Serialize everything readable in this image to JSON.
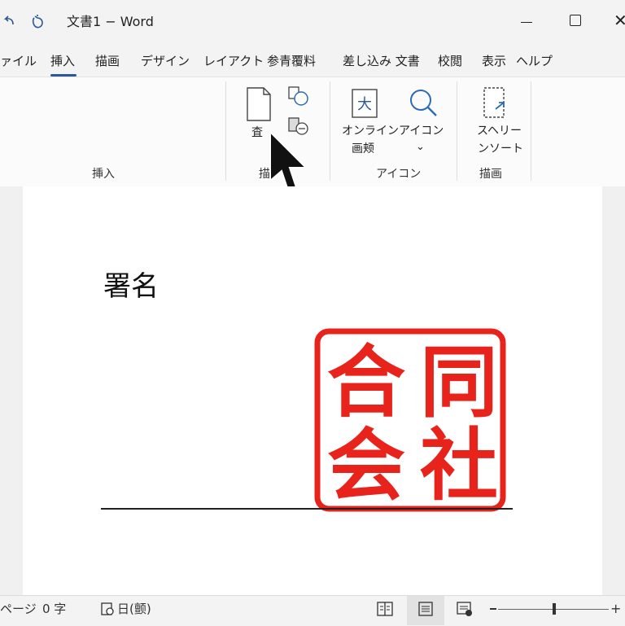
{
  "titlebar": {
    "title": "文書1 − Word",
    "undo_icon": "undo-icon",
    "redo_icon": "touch-mode-icon"
  },
  "tabs": [
    {
      "label": "ァイル",
      "active": false
    },
    {
      "label": "挿入",
      "active": true
    },
    {
      "label": "描画",
      "active": false
    },
    {
      "label": "デザイン",
      "active": false
    },
    {
      "label": "レイアクト",
      "active": false
    },
    {
      "label": "参青覆料",
      "active": false
    },
    {
      "label": "差し込み 文書",
      "active": false
    },
    {
      "label": "校閲",
      "active": false
    },
    {
      "label": "表示",
      "active": false
    },
    {
      "label": "ヘルプ",
      "active": false
    }
  ],
  "ribbon": {
    "groups": [
      {
        "label": "挿入"
      },
      {
        "label": "描"
      },
      {
        "label": "アイコン"
      },
      {
        "label": "描画"
      }
    ],
    "buttons": {
      "page": {
        "label": "査"
      },
      "online": {
        "label_line1": "オンライン",
        "label_line2": "画颊"
      },
      "icons": {
        "label": "アイコン",
        "chevron": "⌄"
      },
      "screenshot": {
        "label_line1": "スヘリー",
        "label_line2": "ンソート"
      }
    }
  },
  "document": {
    "heading": "署名",
    "stamp": {
      "text": "同合社会",
      "color": "#e8231c"
    }
  },
  "statusbar": {
    "page_label": "ページ",
    "word_count": "0 字",
    "language": "日(颤)"
  },
  "colors": {
    "accent": "#2b579a",
    "stamp": "#e8231c"
  }
}
